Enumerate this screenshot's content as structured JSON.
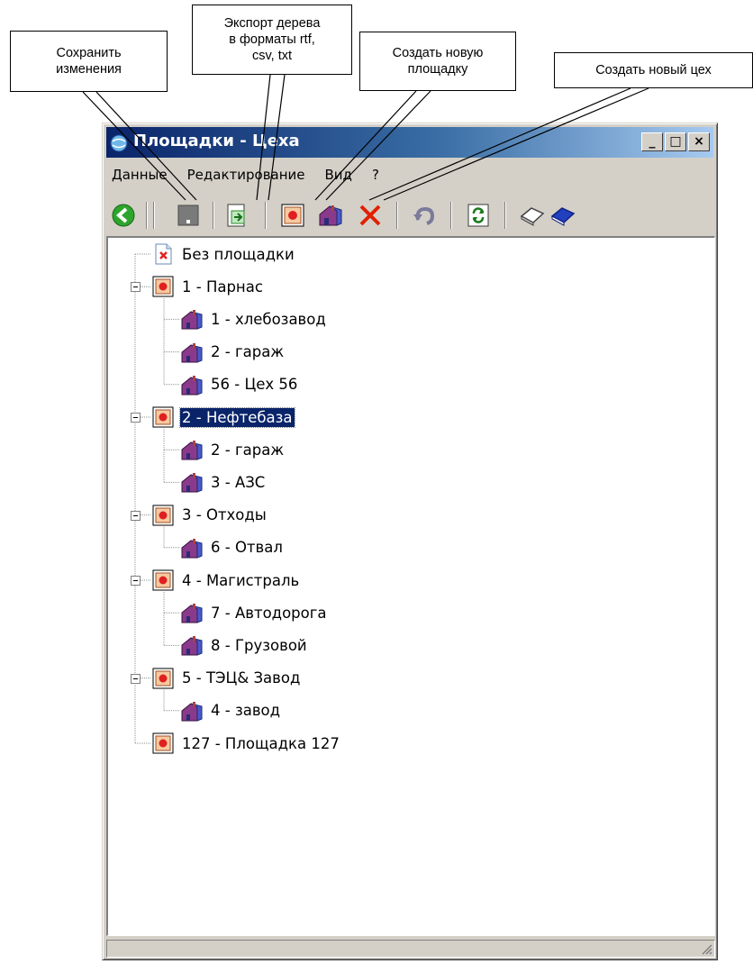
{
  "callouts": {
    "save": "Сохранить\nизменения",
    "export": "Экспорт дерева\nв форматы rtf,\ncsv, txt",
    "new_site": "Создать новую\nплощадку",
    "new_shop": "Создать новый цех"
  },
  "window": {
    "title": "Площадки - Цеха",
    "controls": {
      "minimize": "_",
      "maximize": "□",
      "close": "×"
    }
  },
  "menu": [
    "Данные",
    "Редактирование",
    "Вид",
    "?"
  ],
  "toolbar": [
    {
      "name": "back-icon",
      "color": "#2da52d"
    },
    {
      "name": "save-icon",
      "color": "#7a7a7a"
    },
    {
      "name": "export-icon",
      "color": "#3a8a3a"
    },
    {
      "name": "new-site-icon",
      "color": "#d62020"
    },
    {
      "name": "new-shop-icon",
      "color": "#8a2a8a"
    },
    {
      "name": "delete-icon",
      "color": "#e02000"
    },
    {
      "name": "undo-icon",
      "color": "#7a7a9a"
    },
    {
      "name": "refresh-icon",
      "color": "#2a8a2a"
    },
    {
      "name": "collapse-icon",
      "color": "#808080"
    },
    {
      "name": "expand-icon",
      "color": "#2040c0"
    }
  ],
  "tree": [
    {
      "label": "Без площадки",
      "type": "none",
      "level": 0
    },
    {
      "label": "1 - Парнас",
      "type": "site",
      "level": 0,
      "expanded": true
    },
    {
      "label": "1 - хлебозавод",
      "type": "shop",
      "level": 1
    },
    {
      "label": "2 - гараж",
      "type": "shop",
      "level": 1
    },
    {
      "label": "56 - Цех 56",
      "type": "shop",
      "level": 1
    },
    {
      "label": "2 - Нефтебаза",
      "type": "site",
      "level": 0,
      "expanded": true,
      "selected": true
    },
    {
      "label": "2 - гараж",
      "type": "shop",
      "level": 1
    },
    {
      "label": "3 - АЗС",
      "type": "shop",
      "level": 1
    },
    {
      "label": "3 - Отходы",
      "type": "site",
      "level": 0,
      "expanded": true
    },
    {
      "label": "6 - Отвал",
      "type": "shop",
      "level": 1
    },
    {
      "label": "4 - Магистраль",
      "type": "site",
      "level": 0,
      "expanded": true
    },
    {
      "label": "7 - Автодорога",
      "type": "shop",
      "level": 1
    },
    {
      "label": "8 - Грузовой",
      "type": "shop",
      "level": 1
    },
    {
      "label": "5 - ТЭЦ& Завод",
      "type": "site",
      "level": 0,
      "expanded": true
    },
    {
      "label": "4 - завод",
      "type": "shop",
      "level": 1
    },
    {
      "label": "127 - Площадка 127",
      "type": "site",
      "level": 0
    }
  ]
}
